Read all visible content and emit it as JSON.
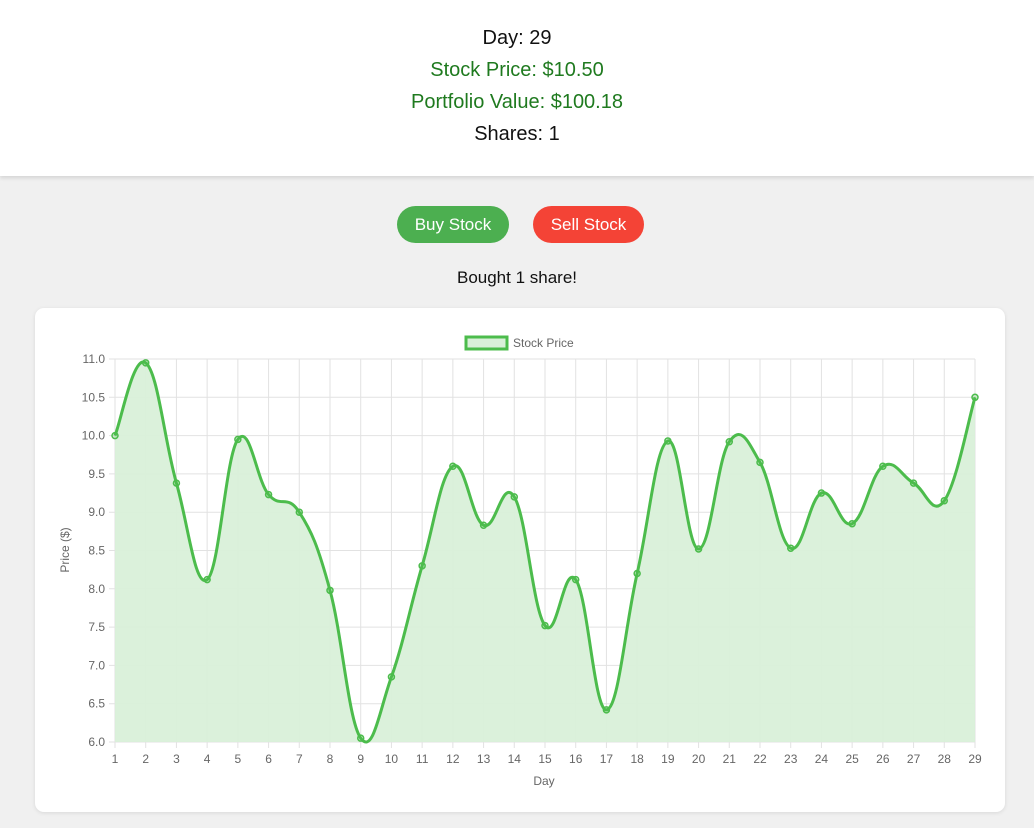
{
  "stats": {
    "day": "Day: 29",
    "price": "Stock Price: $10.50",
    "portfolio": "Portfolio Value: $100.18",
    "shares": "Shares: 1"
  },
  "actions": {
    "buy_label": "Buy Stock",
    "sell_label": "Sell Stock"
  },
  "message": "Bought 1 share!",
  "colors": {
    "buy": "#4caf50",
    "sell": "#f44336",
    "positive_text": "#1f7a1f",
    "line": "#4cbc4c",
    "fill": "#d9f0d9"
  },
  "chart_data": {
    "type": "line",
    "fill": "area",
    "legend": {
      "label": "Stock Price",
      "position": "top-center"
    },
    "xlabel": "Day",
    "ylabel": "Price ($)",
    "ylim": [
      6.0,
      11.0
    ],
    "yticks": [
      "6.0",
      "6.5",
      "7.0",
      "7.5",
      "8.0",
      "8.5",
      "9.0",
      "9.5",
      "10.0",
      "10.5",
      "11.0"
    ],
    "grid": true,
    "x": [
      1,
      2,
      3,
      4,
      5,
      6,
      7,
      8,
      9,
      10,
      11,
      12,
      13,
      14,
      15,
      16,
      17,
      18,
      19,
      20,
      21,
      22,
      23,
      24,
      25,
      26,
      27,
      28,
      29
    ],
    "series": [
      {
        "name": "Stock Price",
        "values": [
          10.0,
          10.95,
          9.38,
          8.12,
          9.95,
          9.23,
          9.0,
          7.98,
          6.05,
          6.85,
          8.3,
          9.6,
          8.83,
          9.2,
          7.52,
          8.12,
          6.42,
          8.2,
          9.93,
          8.52,
          9.92,
          9.65,
          8.53,
          9.25,
          8.85,
          9.6,
          9.38,
          9.15,
          10.5
        ]
      }
    ]
  }
}
